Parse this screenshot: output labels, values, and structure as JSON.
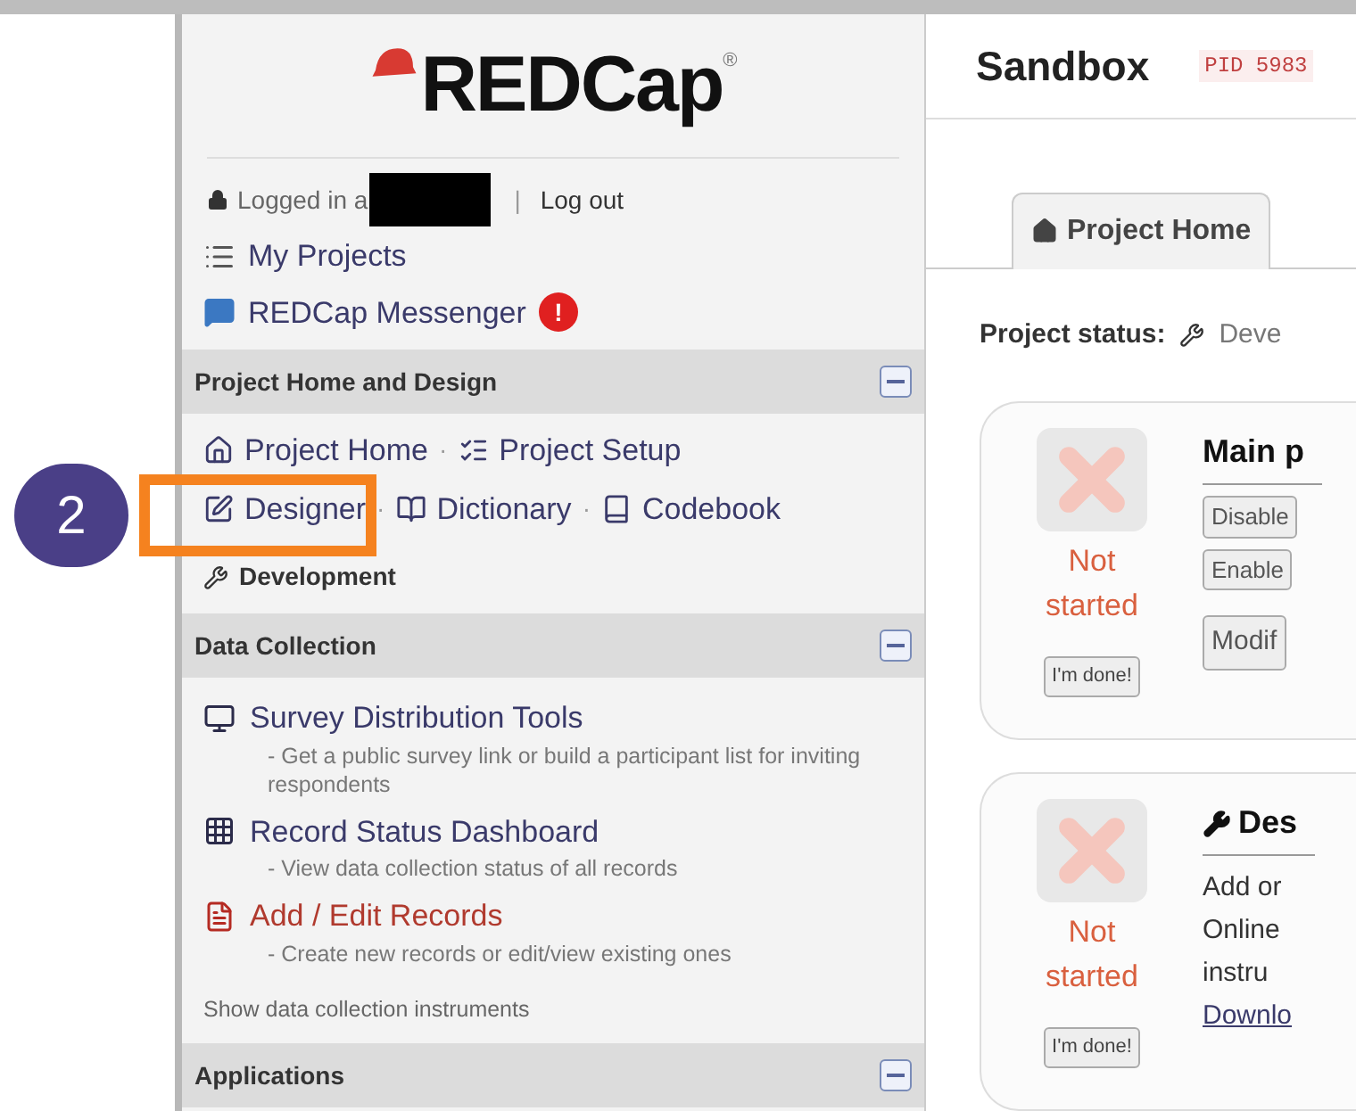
{
  "annotation": {
    "step": "2"
  },
  "sidebar": {
    "logo": "REDCap",
    "logo_mark": "®",
    "login_text": "Logged in a",
    "separator": "|",
    "logout": "Log out",
    "links": [
      {
        "kind": "projects",
        "label": "My Projects"
      },
      {
        "kind": "messenger",
        "label": "REDCap Messenger",
        "alert": "!"
      }
    ],
    "sections": [
      {
        "title": "Project Home and Design",
        "expanded": true,
        "link_rows": [
          [
            {
              "kind": "home",
              "label": "Project Home"
            },
            {
              "kind": "setup",
              "label": "Project Setup"
            }
          ],
          [
            {
              "kind": "designer",
              "label": "Designer"
            },
            {
              "kind": "dictionary",
              "label": "Dictionary"
            },
            {
              "kind": "codebook",
              "label": "Codebook"
            }
          ]
        ],
        "separator": "·",
        "status": "Development"
      },
      {
        "title": "Data Collection",
        "expanded": true,
        "items": [
          {
            "kind": "survey",
            "label": "Survey Distribution Tools",
            "description": "- Get a public survey link or build a participant list for inviting respondents"
          },
          {
            "kind": "dashboard",
            "label": "Record Status Dashboard",
            "description": "- View data collection status of all records"
          },
          {
            "kind": "records",
            "label": "Add / Edit Records",
            "description": "- Create new records or edit/view existing ones"
          }
        ],
        "footer": "Show data collection instruments"
      },
      {
        "title": "Applications",
        "expanded": true
      }
    ]
  },
  "main": {
    "title": "Sandbox",
    "pid": "PID 5983",
    "tabs": [
      {
        "label": "Project Home",
        "selected": true
      }
    ],
    "status_label": "Project status:",
    "status_value": "Deve",
    "cards": [
      {
        "kind": "main",
        "status": "Not started",
        "done_button": "I'm done!",
        "heading": "Main p",
        "buttons": [
          "Disable",
          "Enable",
          "Modif"
        ]
      },
      {
        "kind": "design",
        "status": "Not started",
        "done_button": "I'm done!",
        "heading": "Des",
        "lines": [
          "Add or",
          "Online",
          "instru"
        ],
        "link": "Downlo"
      }
    ]
  }
}
